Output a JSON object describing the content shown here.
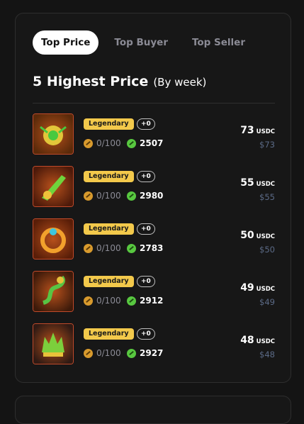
{
  "tabs": [
    {
      "label": "Top Price",
      "active": true
    },
    {
      "label": "Top Buyer",
      "active": false
    },
    {
      "label": "Top Seller",
      "active": false
    }
  ],
  "heading": {
    "title": "5 Highest Price",
    "subtitle": "(By week)"
  },
  "items": [
    {
      "rarity": "Legendary",
      "level": "+0",
      "durability": "0/100",
      "stat": "2507",
      "price": "73",
      "currency": "USDC",
      "usd": "$73",
      "art": "orb",
      "colors": {
        "primary": "#e2c63a",
        "secondary": "#48c93f",
        "bg": "#5a2a0a"
      }
    },
    {
      "rarity": "Legendary",
      "level": "+0",
      "durability": "0/100",
      "stat": "2980",
      "price": "55",
      "currency": "USDC",
      "usd": "$55",
      "art": "blade",
      "colors": {
        "primary": "#6fd43c",
        "secondary": "#f0c23a",
        "bg": "#4d1a0a"
      }
    },
    {
      "rarity": "Legendary",
      "level": "+0",
      "durability": "0/100",
      "stat": "2783",
      "price": "50",
      "currency": "USDC",
      "usd": "$50",
      "art": "ring",
      "colors": {
        "primary": "#f2a12c",
        "secondary": "#3ec6e0",
        "bg": "#5a1e08"
      }
    },
    {
      "rarity": "Legendary",
      "level": "+0",
      "durability": "0/100",
      "stat": "2912",
      "price": "49",
      "currency": "USDC",
      "usd": "$49",
      "art": "serpent",
      "colors": {
        "primary": "#58c444",
        "secondary": "#e6c03a",
        "bg": "#3d1a0a"
      }
    },
    {
      "rarity": "Legendary",
      "level": "+0",
      "durability": "0/100",
      "stat": "2927",
      "price": "48",
      "currency": "USDC",
      "usd": "$48",
      "art": "crown",
      "colors": {
        "primary": "#7ccf3c",
        "secondary": "#e8c23a",
        "bg": "#2f1a14"
      }
    }
  ]
}
